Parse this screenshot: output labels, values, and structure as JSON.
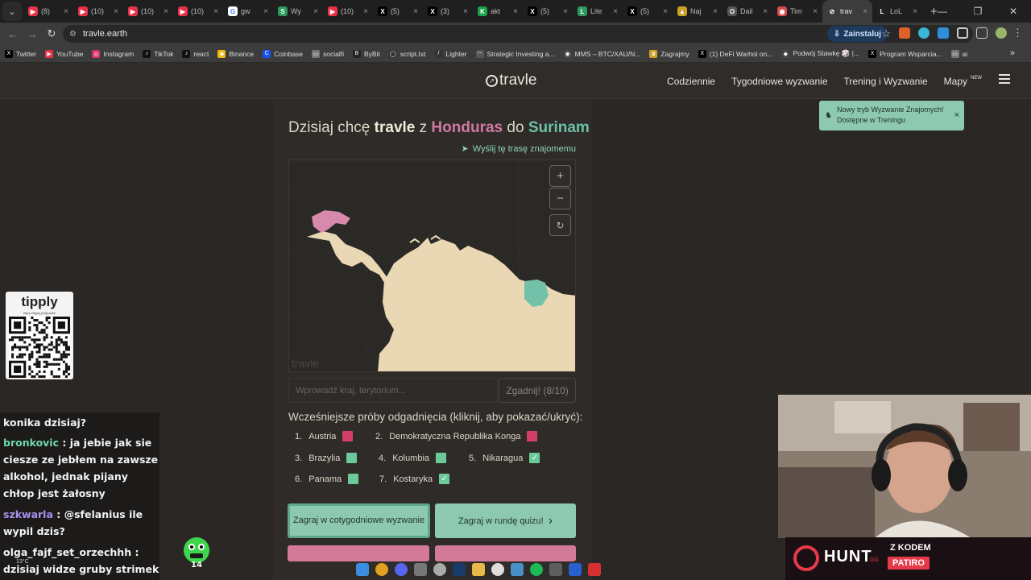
{
  "browser": {
    "tabs": [
      {
        "label": "(8)",
        "color": "#e8324a",
        "glyph": "▶"
      },
      {
        "label": "(10)",
        "color": "#e8324a",
        "glyph": "▶"
      },
      {
        "label": "(10)",
        "color": "#e8324a",
        "glyph": "▶"
      },
      {
        "label": "(10)",
        "color": "#e8324a",
        "glyph": "▶"
      },
      {
        "label": "gw",
        "color": "#ffffff",
        "glyph": "G"
      },
      {
        "label": "Wy",
        "color": "#2e9b5e",
        "glyph": "S"
      },
      {
        "label": "(10)",
        "color": "#e8324a",
        "glyph": "▶"
      },
      {
        "label": "(5)",
        "color": "#000000",
        "glyph": "X"
      },
      {
        "label": "(3)",
        "color": "#000000",
        "glyph": "X"
      },
      {
        "label": "akt",
        "color": "#1aa34a",
        "glyph": "K"
      },
      {
        "label": "(5)",
        "color": "#000000",
        "glyph": "X"
      },
      {
        "label": "Lite",
        "color": "#2e9b5e",
        "glyph": "L"
      },
      {
        "label": "(5)",
        "color": "#000000",
        "glyph": "X"
      },
      {
        "label": "Naj",
        "color": "#c9a227",
        "glyph": "▲"
      },
      {
        "label": "Dail",
        "color": "#555555",
        "glyph": "O"
      },
      {
        "label": "Tim",
        "color": "#d84b4b",
        "glyph": "◉"
      },
      {
        "label": "trav",
        "color": "#3c3c3c",
        "glyph": "⊘",
        "active": true
      },
      {
        "label": "LoL",
        "color": "#222222",
        "glyph": "L"
      }
    ],
    "new_tab": "+",
    "url": "travle.earth",
    "install_label": "Zainstaluj",
    "bookmarks": [
      {
        "label": "Twitter",
        "glyph": "X",
        "color": "#000000"
      },
      {
        "label": "YouTube",
        "glyph": "▶",
        "color": "#e8324a"
      },
      {
        "label": "Instagram",
        "glyph": "◎",
        "color": "#d6336c"
      },
      {
        "label": "TikTok",
        "glyph": "♪",
        "color": "#111111"
      },
      {
        "label": "react",
        "glyph": "♪",
        "color": "#111111"
      },
      {
        "label": "Binance",
        "glyph": "◆",
        "color": "#f0b90b"
      },
      {
        "label": "Coinbase",
        "glyph": "C",
        "color": "#1652f0"
      },
      {
        "label": "socialfi",
        "glyph": "▭",
        "color": "#777777"
      },
      {
        "label": "ByBit",
        "glyph": "B",
        "color": "#222222"
      },
      {
        "label": "script.txt",
        "glyph": "◯",
        "color": "#333333"
      },
      {
        "label": "Lighter",
        "glyph": "/",
        "color": "#333333"
      },
      {
        "label": "Strategic Investing a...",
        "glyph": "◠",
        "color": "#555555"
      },
      {
        "label": "MMS – BTC/XAU/N...",
        "glyph": "◉",
        "color": "#444444"
      },
      {
        "label": "Zagrajmy",
        "glyph": "♛",
        "color": "#c9a227"
      },
      {
        "label": "(1) DeFi Warhol on...",
        "glyph": "X",
        "color": "#000000"
      },
      {
        "label": "Podwój Stawkę 🎲 |...",
        "glyph": "◆",
        "color": "#444444"
      },
      {
        "label": "Program Wsparcia...",
        "glyph": "X",
        "color": "#000000"
      },
      {
        "label": "ai",
        "glyph": "▭",
        "color": "#777777"
      }
    ]
  },
  "site": {
    "logo": "travle",
    "nav": {
      "daily": "Codziennie",
      "weekly": "Tygodniowe wyzwanie",
      "training": "Trening i Wyzwanie",
      "maps": "Mapy",
      "maps_badge": "NEW"
    },
    "headline": {
      "prefix": "Dzisiaj chcę",
      "brand": "travle",
      "from_word": "z",
      "from_country": "Honduras",
      "to_word": "do",
      "to_country": "Surinam"
    },
    "share_label": "Wyślij tę trasę znajomemu",
    "map": {
      "zoom_in": "+",
      "zoom_out": "−",
      "reset": "↻",
      "watermark": "travle",
      "colors": {
        "land": "#ead8b4",
        "start": "#d78aab",
        "end": "#72c1a8",
        "water": "#2b2926"
      }
    },
    "input_placeholder": "Wprowadź kraj, terytorium...",
    "guess_button": "Zgadnij! (8/10)",
    "previous_title": "Wcześniejsze próby odgadnięcia (kliknij, aby pokazać/ukryć):",
    "guesses": [
      {
        "num": "1.",
        "name": "Austria",
        "status": "wrong"
      },
      {
        "num": "2.",
        "name": "Demokratyczna Republika Konga",
        "status": "wrong"
      },
      {
        "num": "3.",
        "name": "Brazylia",
        "status": "close"
      },
      {
        "num": "4.",
        "name": "Kolumbia",
        "status": "close"
      },
      {
        "num": "5.",
        "name": "Nikaragua",
        "status": "correct"
      },
      {
        "num": "6.",
        "name": "Panama",
        "status": "close"
      },
      {
        "num": "7.",
        "name": "Kostaryka",
        "status": "correct"
      }
    ],
    "status_colors": {
      "wrong": "#d63e6a",
      "close": "#6cc99a",
      "correct": "#6cc99a"
    },
    "actions": {
      "weekly": "Zagraj w cotygodniowe wyzwanie",
      "quiz": "Zagraj w rundę quizu!",
      "quiz_arrow": "›"
    },
    "toast": {
      "line1": "Nowy tryb Wyzwanie Znajomych!",
      "line2": "Dostępne w Treningu",
      "close": "×"
    }
  },
  "overlays": {
    "tipply": {
      "logo": "tipply",
      "url": "https://tipply.pl/@patiro"
    },
    "chat": [
      {
        "user": "",
        "text": "konika dzisiaj?"
      },
      {
        "user": "bronkovic",
        "user_color": "green",
        "text": ": ja jebie jak sie ciesze ze jebłem na zawsze alkohol, jednak pijany chłop jest żałosny"
      },
      {
        "user": "szkwarla",
        "user_color": "purple",
        "text": ": @sfelanius ile wypil dzis?"
      },
      {
        "user": "olga_fajf_set_orzechhh",
        "user_color": "white",
        "text": ":"
      },
      {
        "user": "",
        "text": "dzisiaj widze gruby strimek"
      }
    ],
    "hunt": {
      "brand": "HUNT",
      "suffix": "GG",
      "code_label": "Z KODEM",
      "code": "PATIRO"
    },
    "weather": "13°C"
  }
}
